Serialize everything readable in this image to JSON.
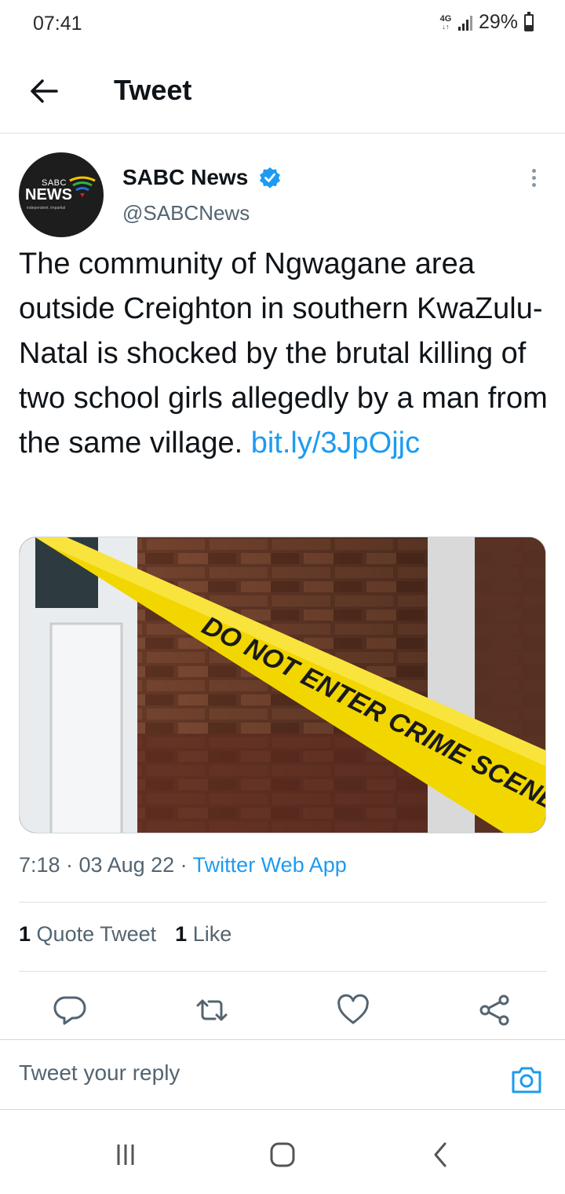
{
  "status_bar": {
    "time": "07:41",
    "network_type": "4G",
    "battery_percent": "29%",
    "battery_level": 0.29
  },
  "header": {
    "title": "Tweet"
  },
  "tweet": {
    "author": {
      "name": "SABC News",
      "handle": "@SABCNews",
      "verified": true,
      "avatar_logo": {
        "line1": "SABC",
        "line2": "NEWS",
        "tagline": "independent. impartial"
      }
    },
    "text": "The community of Ngwagane area outside Creighton in southern KwaZulu-Natal is shocked by the brutal killing of two school girls allegedly by a man from the same village. ",
    "link": "bit.ly/3JpOjjc",
    "media": {
      "tape_text": "DO NOT ENTER CRIME SCENE-DO NOT ENTER CRIME SC"
    },
    "timestamp": "7:18 · 03 Aug 22 · ",
    "source_app": "Twitter Web App",
    "stats": {
      "quote_count": "1",
      "quote_label": "Quote Tweet",
      "like_count": "1",
      "like_label": "Like"
    }
  },
  "reply": {
    "placeholder": "Tweet your reply"
  },
  "colors": {
    "accent": "#1d9bf0",
    "text": "#0f1419",
    "secondary": "#536471",
    "divider": "#dcdfe3"
  },
  "icons": {
    "back": "arrow-left-icon",
    "verified": "verified-badge-icon",
    "more": "more-vertical-icon",
    "reply": "reply-icon",
    "retweet": "retweet-icon",
    "like": "heart-icon",
    "share": "share-icon",
    "camera": "camera-icon",
    "nav_recents": "recents-icon",
    "nav_home": "home-icon",
    "nav_back": "nav-back-icon"
  }
}
